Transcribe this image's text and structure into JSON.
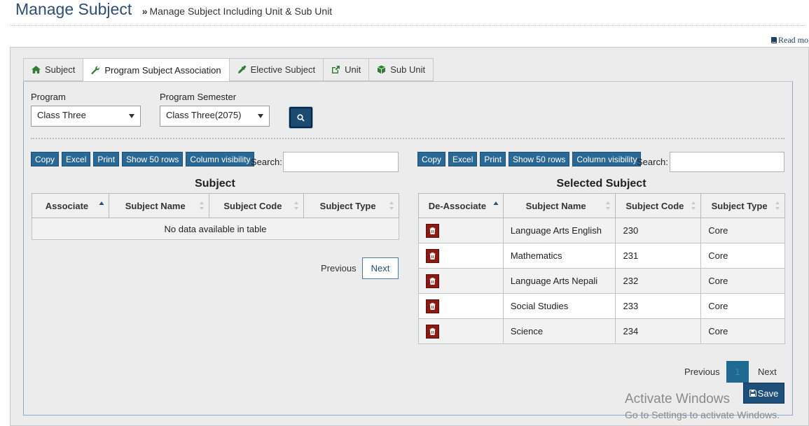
{
  "header": {
    "title": "Manage Subject",
    "subtitle": "Manage Subject Including Unit & Sub Unit",
    "read_more": "Read more"
  },
  "tabs": [
    {
      "label": "Subject",
      "icon": "home-icon"
    },
    {
      "label": "Program Subject Association",
      "icon": "wrench-icon",
      "active": true
    },
    {
      "label": "Elective Subject",
      "icon": "eyedropper-icon"
    },
    {
      "label": "Unit",
      "icon": "external-link-icon"
    },
    {
      "label": "Sub Unit",
      "icon": "cube-icon"
    }
  ],
  "filters": {
    "program_label": "Program",
    "program_value": "Class Three",
    "semester_label": "Program Semester",
    "semester_value": "Class Three(2075)"
  },
  "toolbar": {
    "copy": "Copy",
    "excel": "Excel",
    "print": "Print",
    "show_rows": "Show 50 rows",
    "column_visibility": "Column visibility",
    "search_label": "Search:"
  },
  "left_table": {
    "title": "Subject",
    "columns": [
      "Associate",
      "Subject Name",
      "Subject Code",
      "Subject Type"
    ],
    "empty_message": "No data available in table",
    "pager": {
      "previous": "Previous",
      "next": "Next"
    }
  },
  "right_table": {
    "title": "Selected Subject",
    "columns": [
      "De-Associate",
      "Subject Name",
      "Subject Code",
      "Subject Type"
    ],
    "rows": [
      {
        "name": "Language Arts English",
        "code": "230",
        "type": "Core"
      },
      {
        "name": "Mathematics",
        "code": "231",
        "type": "Core"
      },
      {
        "name": "Language Arts Nepali",
        "code": "232",
        "type": "Core"
      },
      {
        "name": "Social Studies",
        "code": "233",
        "type": "Core"
      },
      {
        "name": "Science",
        "code": "234",
        "type": "Core"
      }
    ],
    "pager": {
      "previous": "Previous",
      "current_page": "1",
      "next": "Next"
    }
  },
  "save_label": "Save",
  "watermark": {
    "title": "Activate Windows",
    "subtitle": "Go to Settings to activate Windows."
  },
  "colors": {
    "primary": "#1e4e7a",
    "toolbar_button": "#2a6896",
    "delete_button": "#8b1a14",
    "title_text": "#2c4f73"
  }
}
